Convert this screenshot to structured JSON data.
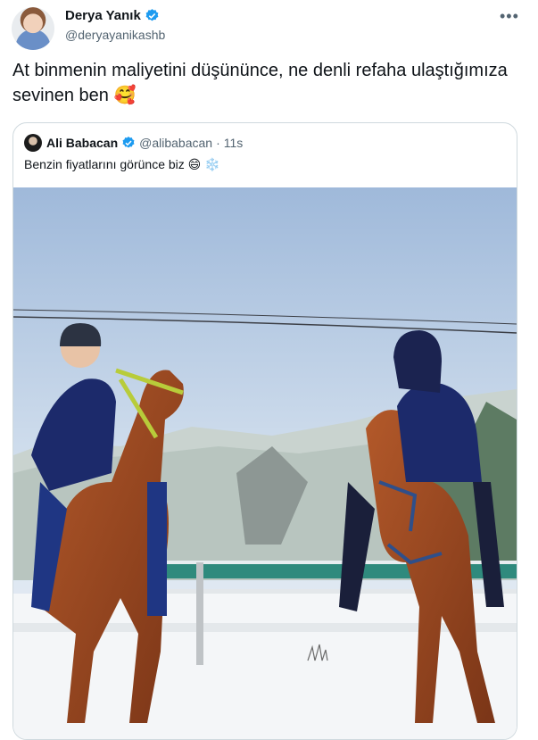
{
  "tweet": {
    "author_name": "Derya Yanık",
    "author_handle": "@deryayanikashb",
    "text": "At binmenin maliyetini düşününce, ne denli refaha ulaştığımıza sevinen ben",
    "text_emoji": "🥰",
    "more_label": "•••"
  },
  "quoted": {
    "author_name": "Ali Babacan",
    "author_handle": "@alibabacan",
    "separator": "·",
    "time": "11s",
    "text": "Benzin fiyatlarını görünce biz",
    "emoji_1": "😄",
    "emoji_2": "❄️"
  },
  "icons": {
    "verified": "verified-badge-icon",
    "more": "more-icon"
  },
  "colors": {
    "verified": "#1d9bf0",
    "secondary_text": "#536471",
    "border": "#cfd9de"
  }
}
